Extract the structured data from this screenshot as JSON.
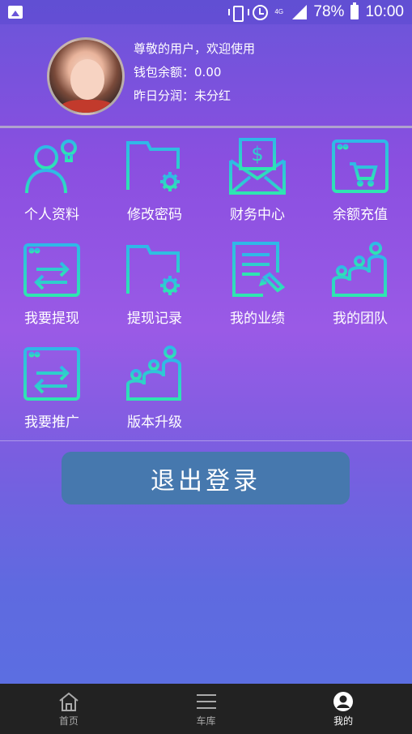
{
  "status_bar": {
    "battery": "78%",
    "time": "10:00",
    "network": "4G"
  },
  "profile": {
    "greeting": "尊敬的用户，欢迎使用",
    "wallet_label": "钱包余额：",
    "wallet_value": "0.00",
    "yesterday_label": "昨日分润：",
    "yesterday_value": "未分红"
  },
  "menu": [
    {
      "label": "个人资料",
      "icon": "user-icon"
    },
    {
      "label": "修改密码",
      "icon": "folder-settings-icon"
    },
    {
      "label": "财务中心",
      "icon": "money-envelope-icon"
    },
    {
      "label": "余额充值",
      "icon": "cart-window-icon"
    },
    {
      "label": "我要提现",
      "icon": "transfer-window-icon"
    },
    {
      "label": "提现记录",
      "icon": "folder-settings-icon"
    },
    {
      "label": "我的业绩",
      "icon": "document-edit-icon"
    },
    {
      "label": "我的团队",
      "icon": "team-icon"
    },
    {
      "label": "我要推广",
      "icon": "transfer-window-icon"
    },
    {
      "label": "版本升级",
      "icon": "team-icon"
    }
  ],
  "logout_label": "退出登录",
  "bottom_nav": [
    {
      "label": "首页",
      "icon": "home-icon"
    },
    {
      "label": "车库",
      "icon": "list-icon"
    },
    {
      "label": "我的",
      "icon": "profile-icon"
    }
  ],
  "colors": {
    "icon_gradient_top": "#2fb8e8",
    "icon_gradient_bottom": "#2ee6b0",
    "logout_button": "#4678ae",
    "nav_background": "#222222"
  }
}
